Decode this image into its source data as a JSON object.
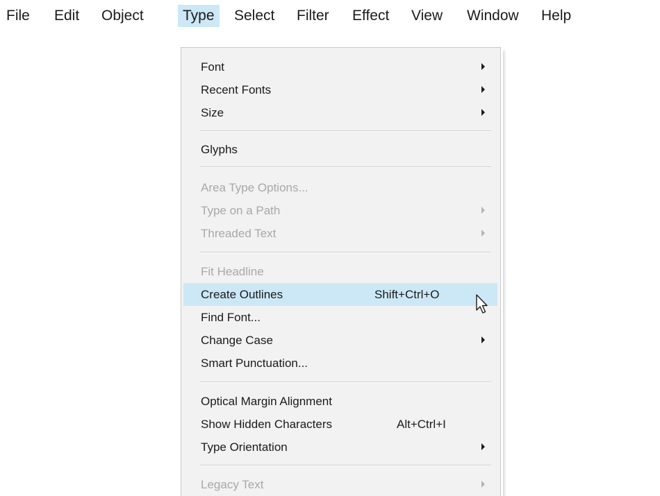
{
  "menubar": {
    "items": [
      {
        "label": "File"
      },
      {
        "label": "Edit"
      },
      {
        "label": "Object"
      },
      {
        "label": "Type"
      },
      {
        "label": "Select"
      },
      {
        "label": "Filter"
      },
      {
        "label": "Effect"
      },
      {
        "label": "View"
      },
      {
        "label": "Window"
      },
      {
        "label": "Help"
      }
    ],
    "active": "Type"
  },
  "type_menu": {
    "items": [
      {
        "label": "Font",
        "shortcut": "",
        "submenu": true,
        "enabled": true
      },
      {
        "label": "Recent Fonts",
        "shortcut": "",
        "submenu": true,
        "enabled": true
      },
      {
        "label": "Size",
        "shortcut": "",
        "submenu": true,
        "enabled": true
      },
      {
        "label": "Glyphs",
        "shortcut": "",
        "submenu": false,
        "enabled": true
      },
      {
        "label": "Area Type Options...",
        "shortcut": "",
        "submenu": false,
        "enabled": false
      },
      {
        "label": "Type on a Path",
        "shortcut": "",
        "submenu": true,
        "enabled": false
      },
      {
        "label": "Threaded Text",
        "shortcut": "",
        "submenu": true,
        "enabled": false
      },
      {
        "label": "Fit Headline",
        "shortcut": "",
        "submenu": false,
        "enabled": false
      },
      {
        "label": "Create Outlines",
        "shortcut": "Shift+Ctrl+O",
        "submenu": false,
        "enabled": true,
        "highlighted": true
      },
      {
        "label": "Find Font...",
        "shortcut": "",
        "submenu": false,
        "enabled": true
      },
      {
        "label": "Change Case",
        "shortcut": "",
        "submenu": true,
        "enabled": true
      },
      {
        "label": "Smart Punctuation...",
        "shortcut": "",
        "submenu": false,
        "enabled": true
      },
      {
        "label": "Optical Margin Alignment",
        "shortcut": "",
        "submenu": false,
        "enabled": true
      },
      {
        "label": "Show Hidden Characters",
        "shortcut": "Alt+Ctrl+I",
        "submenu": false,
        "enabled": true
      },
      {
        "label": "Type Orientation",
        "shortcut": "",
        "submenu": true,
        "enabled": true
      },
      {
        "label": "Legacy Text",
        "shortcut": "",
        "submenu": true,
        "enabled": false
      }
    ]
  },
  "colors": {
    "highlight": "#cce8f6",
    "menu_background": "#f2f2f2",
    "disabled_text": "#a8a8a8"
  },
  "icons": {
    "submenu": "chevron-right-icon",
    "cursor": "mouse-pointer-icon"
  }
}
